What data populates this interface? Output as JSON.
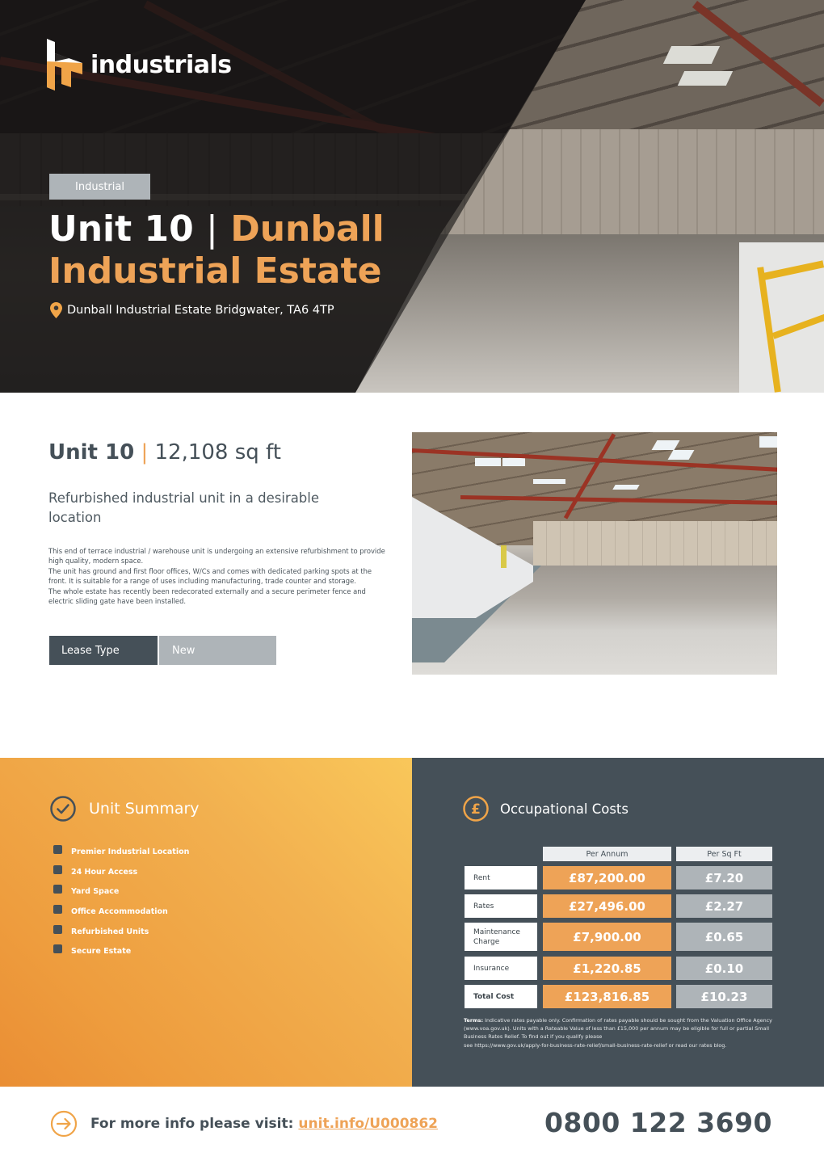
{
  "brand": {
    "name": "industrials",
    "accent_color": "#eea357",
    "dark_color": "#455058",
    "grey_color": "#aeb4b8"
  },
  "hero": {
    "badge": "Industrial",
    "title_unit": "Unit 10",
    "title_separator": "|",
    "title_estate": "Dunball Industrial Estate",
    "address_icon": "location-pin-icon",
    "address": "Dunball Industrial Estate Bridgwater, TA6 4TP"
  },
  "details": {
    "unit_name": "Unit 10",
    "separator": "|",
    "size": "12,108 sq ft",
    "subtitle": "Refurbished industrial unit in a desirable location",
    "description": [
      "This end of terrace industrial / warehouse unit is undergoing an extensive refurbishment to provide high quality, modern space.",
      "The unit has ground and first floor offices, W/Cs and comes with dedicated parking spots at the front. It is suitable for a range of uses including manufacturing, trade counter and storage.",
      "The whole estate has recently been redecorated externally and a secure perimeter fence and electric sliding gate have been installed."
    ],
    "lease_label": "Lease Type",
    "lease_value": "New",
    "photo_alt": "Interior of empty industrial warehouse unit"
  },
  "summary": {
    "icon": "check-circle-icon",
    "title": "Unit Summary",
    "items": [
      "Premier Industrial Location",
      "24 Hour Access",
      "Yard Space",
      "Office Accommodation",
      "Refurbished Units",
      "Secure Estate"
    ]
  },
  "costs": {
    "icon": "pound-circle-icon",
    "title": "Occupational Costs",
    "columns": [
      "Per Annum",
      "Per Sq Ft"
    ],
    "rows": [
      {
        "label": "Rent",
        "per_annum": "£87,200.00",
        "per_sq_ft": "£7.20"
      },
      {
        "label": "Rates",
        "per_annum": "£27,496.00",
        "per_sq_ft": "£2.27"
      },
      {
        "label": "Maintenance Charge",
        "per_annum": "£7,900.00",
        "per_sq_ft": "£0.65"
      },
      {
        "label": "Insurance",
        "per_annum": "£1,220.85",
        "per_sq_ft": "£0.10"
      },
      {
        "label": "Total Cost",
        "per_annum": "£123,816.85",
        "per_sq_ft": "£10.23"
      }
    ],
    "terms_label": "Terms:",
    "terms_text": "Indicative rates payable only. Confirmation of rates payable should be sought from the Valuation Office Agency (www.voa.gov.uk). Units with a Rateable Value of less than £15,000 per annum may be eligible for full or partial Small Business Rates Relief. To find out if you qualify please",
    "terms_text_2": "see https://www.gov.uk/apply-for-business-rate-relief/small-business-rate-relief or read our rates blog."
  },
  "footer": {
    "icon": "arrow-right-circle-icon",
    "info_text": "For more info please visit:",
    "link_text": "unit.info/U000862",
    "phone": "0800 122 3690"
  }
}
